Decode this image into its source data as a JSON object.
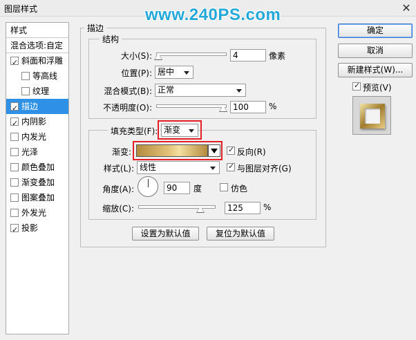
{
  "window": {
    "title": "图层样式",
    "close_glyph": "✕",
    "watermark": "www.240PS.com"
  },
  "sidebar": {
    "header": "样式",
    "blend_options": "混合选项:自定",
    "items": [
      {
        "label": "斜面和浮雕",
        "checked": true
      },
      {
        "label": "等高线",
        "checked": false
      },
      {
        "label": "纹理",
        "checked": false
      },
      {
        "label": "描边",
        "checked": true,
        "selected": true
      },
      {
        "label": "内阴影",
        "checked": true
      },
      {
        "label": "内发光",
        "checked": false
      },
      {
        "label": "光泽",
        "checked": false
      },
      {
        "label": "颜色叠加",
        "checked": false
      },
      {
        "label": "渐变叠加",
        "checked": false
      },
      {
        "label": "图案叠加",
        "checked": false
      },
      {
        "label": "外发光",
        "checked": false
      },
      {
        "label": "投影",
        "checked": true
      }
    ]
  },
  "stroke": {
    "section_title": "描边",
    "structure": {
      "title": "结构",
      "size_label": "大小(S):",
      "size_value": "4",
      "size_unit": "像素",
      "position_label": "位置(P):",
      "position_value": "居中",
      "blend_label": "混合模式(B):",
      "blend_value": "正常",
      "opacity_label": "不透明度(O):",
      "opacity_value": "100",
      "opacity_unit": "%"
    },
    "fill": {
      "type_label": "填充类型(F):",
      "type_value": "渐变",
      "gradient_label": "渐变:",
      "reverse_label": "反向(R)",
      "reverse_checked": true,
      "style_label": "样式(L):",
      "style_value": "线性",
      "align_label": "与图层对齐(G)",
      "align_checked": true,
      "angle_label": "角度(A):",
      "angle_value": "90",
      "angle_unit": "度",
      "dither_label": "仿色",
      "dither_checked": false,
      "scale_label": "缩放(C):",
      "scale_value": "125",
      "scale_unit": "%"
    },
    "set_default": "设置为默认值",
    "reset_default": "复位为默认值"
  },
  "buttons": {
    "ok": "确定",
    "cancel": "取消",
    "new_style": "新建样式(W)...",
    "preview_label": "预览(V)",
    "preview_checked": true
  },
  "colors": {
    "selection": "#2f91e6",
    "highlight_box": "#e31e24",
    "watermark": "#23a8d9"
  }
}
